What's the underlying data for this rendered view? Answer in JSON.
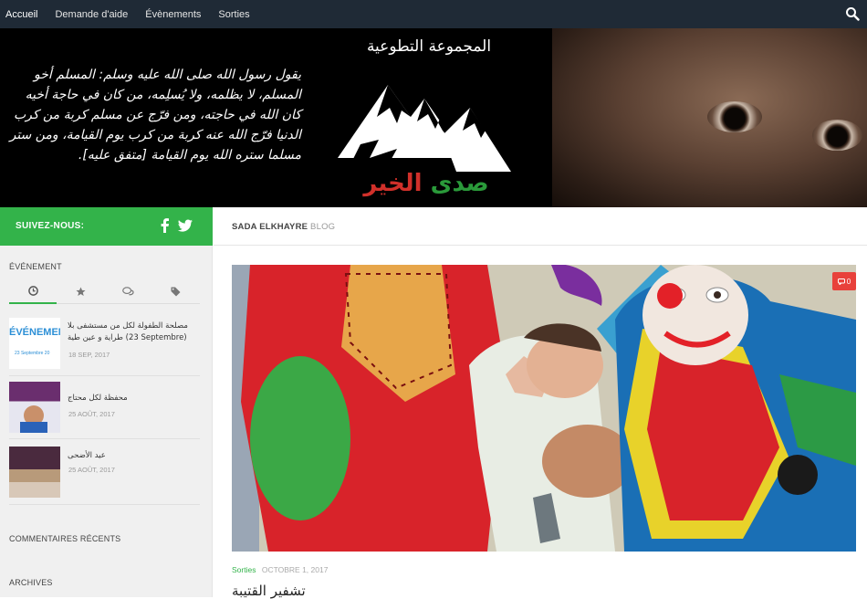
{
  "nav": {
    "items": [
      {
        "label": "Accueil"
      },
      {
        "label": "Demande d'aide"
      },
      {
        "label": "Évènements"
      },
      {
        "label": "Sorties"
      }
    ]
  },
  "header": {
    "quote": "يقول رسول الله صلى الله عليه وسلم: المسلم أخو المسلم، لا يظلمه، ولا يُسلِمه، من كان في حاجة أخيه كان الله في حاجته، ومن فرّج عن مسلم كربة من كرب الدنيا فرّج الله عنه كربة من كرب يوم القيامة، ومن ستر مسلما ستره الله يوم القيامة [متفق عليه].",
    "group_title": "المجموعة التطوعية",
    "logo_text_green": "صدى",
    "logo_text_red": "الخير"
  },
  "sidebar": {
    "follow_label": "SUIVEZ-NOUS:",
    "widget_title": "ÉVÉNEMENT",
    "posts": [
      {
        "title": "مصلحة الطفولة لكل من مستشفى بلا طراية و عين طية (23 Septembre)",
        "date": "18 SEP, 2017",
        "thumb_text": "ÉVÉNEMEN",
        "thumb_sub": "23 Septembre 20"
      },
      {
        "title": "محفظة لكل محتاج",
        "date": "25 AOÛT, 2017"
      },
      {
        "title": "عيد الأضحى",
        "date": "25 AOÛT, 2017"
      }
    ],
    "recent_comments": "COMMENTAIRES RÉCENTS",
    "archives": "ARCHIVES"
  },
  "main": {
    "blog_name": "SADA ELKHAYRE",
    "blog_suffix": "BLOG",
    "comment_count": "0",
    "category": "Sorties",
    "date": "OCTOBRE 1, 2017",
    "title": "تشفير القتيبة"
  },
  "colors": {
    "nav_bg": "#1f2a36",
    "accent_green": "#33b34a",
    "badge_red": "#e8413b"
  }
}
